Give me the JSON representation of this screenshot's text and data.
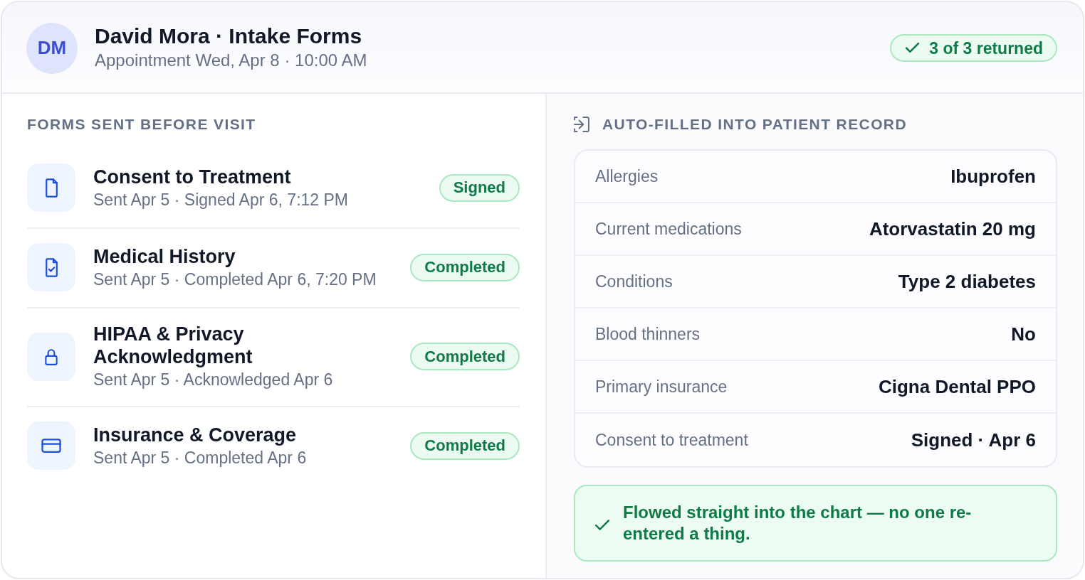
{
  "header": {
    "avatar_initials": "DM",
    "title": "David Mora · Intake Forms",
    "subtitle": "Appointment Wed, Apr 8 · 10:00 AM",
    "badge": "3 of 3 returned"
  },
  "forms_panel": {
    "heading": "FORMS SENT BEFORE VISIT",
    "forms": [
      {
        "kind": "consent",
        "title": "Consent to Treatment",
        "detail": "Sent Apr 5 · Signed Apr 6, 7:12 PM",
        "status": "Signed"
      },
      {
        "kind": "history",
        "title": "Medical History",
        "detail": "Sent Apr 5 · Completed Apr 6, 7:20 PM",
        "status": "Completed"
      },
      {
        "kind": "privacy",
        "title": "HIPAA & Privacy Acknowledgment",
        "detail": "Sent Apr 5 · Acknowledged Apr 6",
        "status": "Completed"
      },
      {
        "kind": "insurance",
        "title": "Insurance & Coverage",
        "detail": "Sent Apr 5 · Completed Apr 6",
        "status": "Completed"
      }
    ]
  },
  "record_panel": {
    "heading": "AUTO-FILLED INTO PATIENT RECORD",
    "fields": [
      {
        "label": "Allergies",
        "value": "Ibuprofen"
      },
      {
        "label": "Current medications",
        "value": "Atorvastatin 20 mg"
      },
      {
        "label": "Conditions",
        "value": "Type 2 diabetes"
      },
      {
        "label": "Blood thinners",
        "value": "No"
      },
      {
        "label": "Primary insurance",
        "value": "Cigna Dental PPO"
      },
      {
        "label": "Consent to treatment",
        "value": "Signed · Apr 6"
      }
    ],
    "note": "Flowed straight into the chart — no one re-entered a thing."
  }
}
